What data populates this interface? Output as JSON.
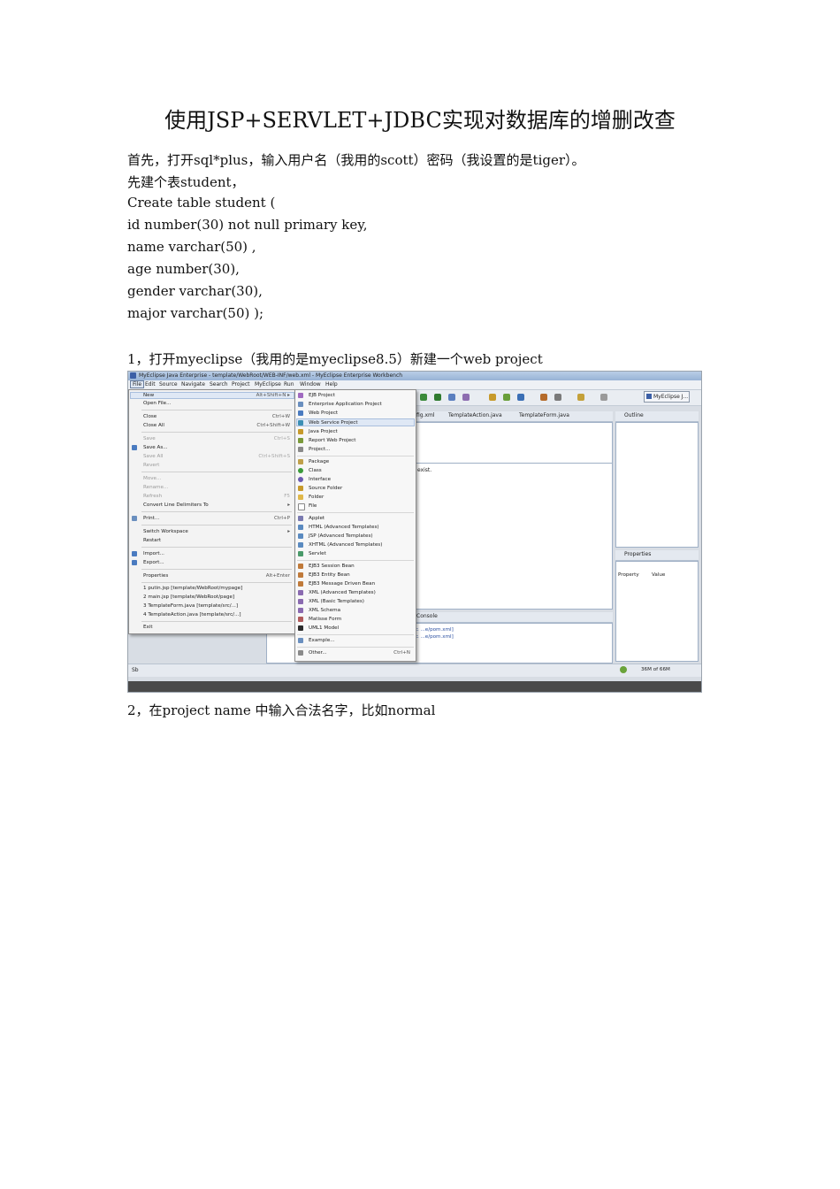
{
  "doc": {
    "title": "使用JSP+SERVLET+JDBC实现对数据库的增删改查",
    "paragraphs": [
      "首先，打开sql*plus，输入用户名（我用的scott）密码（我设置的是tiger）。",
      "先建个表student，",
      "Create table student (",
      "id number(30) not null primary key,",
      "name varchar(50) ,",
      "age number(30),",
      "gender varchar(30),",
      "major varchar(50) );",
      "1，打开myeclipse（我用的是myeclipse8.5）新建一个web project",
      "2，在project name  中输入合法名字，比如normal"
    ]
  },
  "screenshot": {
    "window_title": "MyEclipse Java Enterprise - template/WebRoot/WEB-INF/web.xml - MyEclipse Enterprise Workbench",
    "menubar": [
      "File",
      "Edit",
      "Source",
      "Navigate",
      "Search",
      "Project",
      "MyEclipse",
      "Run",
      "Window",
      "Help"
    ],
    "perspective": "MyEclipse J...",
    "editor_tabs": [
      "fig.xml",
      "TemplateAction.java",
      "TemplateForm.java"
    ],
    "editor_text": "exist.",
    "outline_title": "Outline",
    "properties_title": "Properties",
    "properties_cols": [
      "Property",
      "Value"
    ],
    "console_title": "Console",
    "console_lines": [
      "11-8-7 上 ...e/pom.xml]",
      "11-8-7 上 ...e/pom.xml]"
    ],
    "status_left": "Sb",
    "status_right": [
      "36M of 66M"
    ],
    "file_menu": [
      {
        "label": "New",
        "key": "Alt+Shift+N ▸",
        "dis": false
      },
      {
        "label": "Open File...",
        "key": "",
        "dis": false
      },
      {
        "label": "Close",
        "key": "Ctrl+W",
        "dis": false
      },
      {
        "label": "Close All",
        "key": "Ctrl+Shift+W",
        "dis": false
      },
      {
        "label": "Save",
        "key": "Ctrl+S",
        "dis": true
      },
      {
        "label": "Save As...",
        "key": "",
        "dis": false
      },
      {
        "label": "Save All",
        "key": "Ctrl+Shift+S",
        "dis": true
      },
      {
        "label": "Revert",
        "key": "",
        "dis": true
      },
      {
        "label": "Move...",
        "key": "",
        "dis": true
      },
      {
        "label": "Rename...",
        "key": "",
        "dis": true
      },
      {
        "label": "Refresh",
        "key": "F5",
        "dis": true
      },
      {
        "label": "Convert Line Delimiters To",
        "key": "▸",
        "dis": false
      },
      {
        "label": "Print...",
        "key": "Ctrl+P",
        "dis": false
      },
      {
        "label": "Switch Workspace",
        "key": "▸",
        "dis": false
      },
      {
        "label": "Restart",
        "key": "",
        "dis": false
      },
      {
        "label": "Import...",
        "key": "",
        "dis": false
      },
      {
        "label": "Export...",
        "key": "",
        "dis": false
      },
      {
        "label": "Properties",
        "key": "Alt+Enter",
        "dis": false
      },
      {
        "label": "1 putin.jsp  [template/WebRoot/mypage]",
        "key": "",
        "dis": false
      },
      {
        "label": "2 main.jsp  [template/WebRoot/page]",
        "key": "",
        "dis": false
      },
      {
        "label": "3 TemplateForm.java  [template/src/...]",
        "key": "",
        "dis": false
      },
      {
        "label": "4 TemplateAction.java  [template/src/...]",
        "key": "",
        "dis": false
      },
      {
        "label": "Exit",
        "key": "",
        "dis": false
      }
    ],
    "new_submenu": [
      "EJB Project",
      "Enterprise Application Project",
      "Web Project",
      "Web Service Project",
      "Java Project",
      "Report Web Project",
      "Project...",
      "Package",
      "Class",
      "Interface",
      "Source Folder",
      "Folder",
      "File",
      "Applet",
      "HTML (Advanced Templates)",
      "JSP (Advanced Templates)",
      "XHTML (Advanced Templates)",
      "Servlet",
      "EJB3 Session Bean",
      "EJB3 Entity Bean",
      "EJB3 Message Driven Bean",
      "XML (Advanced Templates)",
      "XML (Basic Templates)",
      "XML Schema",
      "Matisse Form",
      "UML1 Model",
      "Example...",
      "Other..."
    ],
    "new_submenu_other_key": "Ctrl+N",
    "colors": {
      "accent": "#3b5fa6",
      "highlight": "#dfe8f5"
    }
  }
}
